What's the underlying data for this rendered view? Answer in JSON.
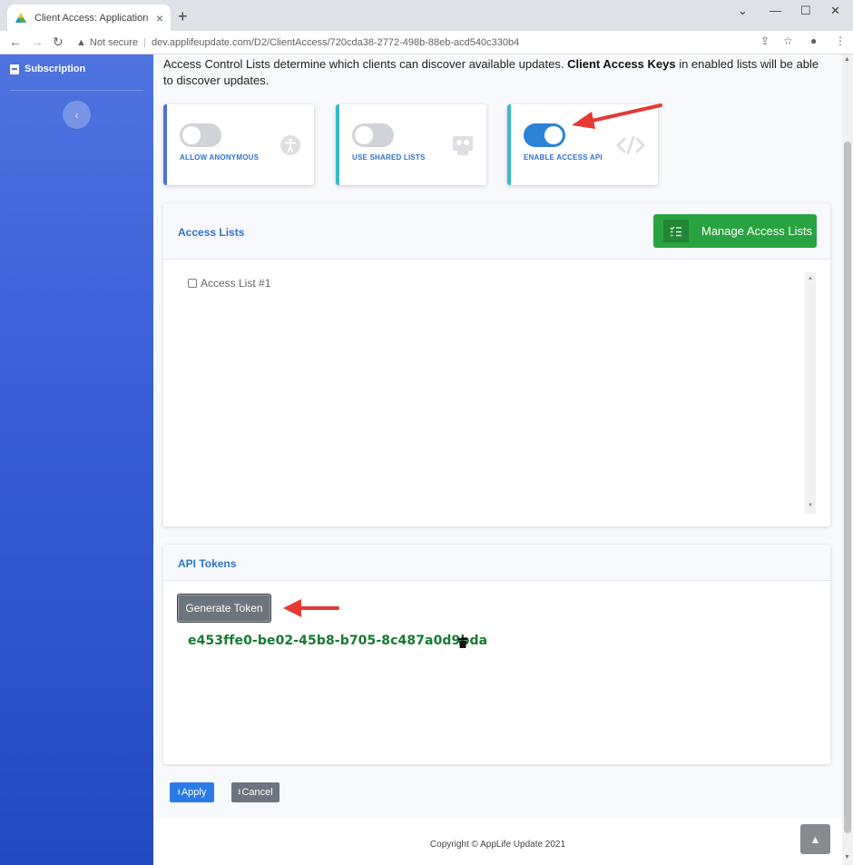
{
  "browser": {
    "tab_title": "Client Access: Application My Ap",
    "security_label": "Not secure",
    "url": "dev.applifeupdate.com/D2/ClientAccess/720cda38-2772-498b-88eb-acd540c330b4"
  },
  "sidebar": {
    "item_label": "Subscription"
  },
  "intro": {
    "text_before": "Access Control Lists determine which clients can discover available updates. ",
    "bold": "Client Access Keys",
    "text_after": " in enabled lists will be able to discover updates."
  },
  "toggles": [
    {
      "label": "ALLOW ANONYMOUS",
      "on": false,
      "icon": "accessibility-icon"
    },
    {
      "label": "USE SHARED LISTS",
      "on": false,
      "icon": "shared-lists-icon"
    },
    {
      "label": "ENABLE ACCESS API",
      "on": true,
      "icon": "code-icon"
    }
  ],
  "access_lists": {
    "title": "Access Lists",
    "manage_button": "Manage Access Lists",
    "items": [
      "Access List #1"
    ]
  },
  "api_tokens": {
    "title": "API Tokens",
    "generate_button": "Generate Token",
    "token": "e453ffe0-be02-45b8-b705-8c487a0d9bda"
  },
  "actions": {
    "apply": "Apply",
    "cancel": "Cancel"
  },
  "footer": {
    "copyright": "Copyright © AppLife Update 2021"
  },
  "colors": {
    "sidebar": "#4e73df",
    "accent_text": "#2f72c9",
    "success": "#29a341",
    "token": "#157a2f",
    "annotation_arrow": "#e53935"
  }
}
